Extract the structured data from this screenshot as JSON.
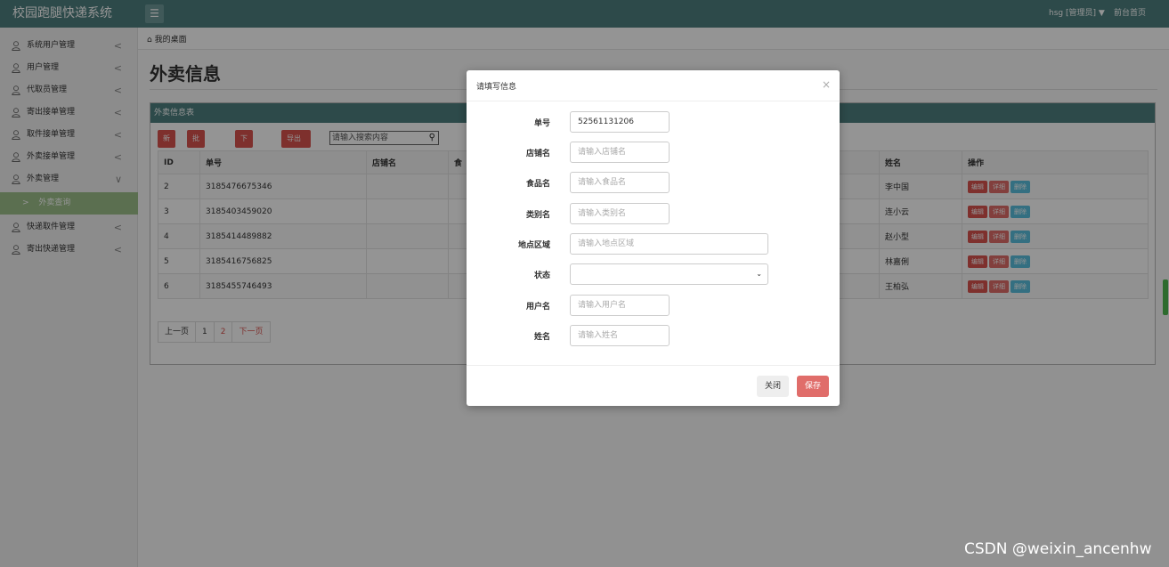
{
  "app": {
    "title": "校园跑腿快递系统"
  },
  "header": {
    "menu_icon": "☰",
    "user": "hsg [管理员]",
    "user_caret": "▼",
    "front_link": "前台首页"
  },
  "sidebar": {
    "items": [
      {
        "label": "系统用户管理",
        "chevron": "<"
      },
      {
        "label": "用户管理",
        "chevron": "<"
      },
      {
        "label": "代取员管理",
        "chevron": "<"
      },
      {
        "label": "寄出接单管理",
        "chevron": "<"
      },
      {
        "label": "取件接单管理",
        "chevron": "<"
      },
      {
        "label": "外卖接单管理",
        "chevron": "<"
      },
      {
        "label": "外卖管理",
        "chevron": "∨"
      },
      {
        "label": "外卖查询",
        "chevron": ">"
      },
      {
        "label": "快递取件管理",
        "chevron": "<"
      },
      {
        "label": "寄出快递管理",
        "chevron": "<"
      }
    ]
  },
  "breadcrumb": {
    "home_icon": "⌂",
    "label": "我的桌面"
  },
  "page": {
    "title": "外卖信息"
  },
  "panel": {
    "title": "外卖信息表",
    "toolbar": {
      "add": "新增",
      "import": "批量导入",
      "download_template": "下载模板",
      "export": "导出excel"
    },
    "search": {
      "placeholder": "请输入搜索内容",
      "icon": "🔍"
    },
    "columns": [
      "ID",
      "单号",
      "店铺名",
      "食",
      "姓名",
      "操作"
    ],
    "rows": [
      {
        "id": "2",
        "no": "3185476675346",
        "name": "李中国"
      },
      {
        "id": "3",
        "no": "3185403459020",
        "name": "连小云"
      },
      {
        "id": "4",
        "no": "3185414489882",
        "name": "赵小型"
      },
      {
        "id": "5",
        "no": "3185416756825",
        "name": "林嘉俐"
      },
      {
        "id": "6",
        "no": "3185455746493",
        "name": "王柏弘"
      }
    ],
    "actions": {
      "edit": "编辑",
      "detail": "详细",
      "delete": "删除"
    },
    "pager": {
      "prev": "上一页",
      "p1": "1",
      "p2": "2",
      "next": "下一页"
    }
  },
  "modal": {
    "title": "请填写信息",
    "close_icon": "×",
    "fields": {
      "order_no": {
        "label": "单号",
        "value": "52561131206"
      },
      "shop": {
        "label": "店铺名",
        "placeholder": "请输入店铺名"
      },
      "food": {
        "label": "食品名",
        "placeholder": "请输入食品名"
      },
      "category": {
        "label": "类别名",
        "placeholder": "请输入类别名"
      },
      "area": {
        "label": "地点区域",
        "placeholder": "请输入地点区域"
      },
      "status": {
        "label": "状态",
        "value": ""
      },
      "username": {
        "label": "用户名",
        "placeholder": "请输入用户名"
      },
      "realname": {
        "label": "姓名",
        "placeholder": "请输入姓名"
      }
    },
    "buttons": {
      "close": "关闭",
      "save": "保存"
    }
  },
  "watermark": "CSDN @weixin_ancenhw"
}
